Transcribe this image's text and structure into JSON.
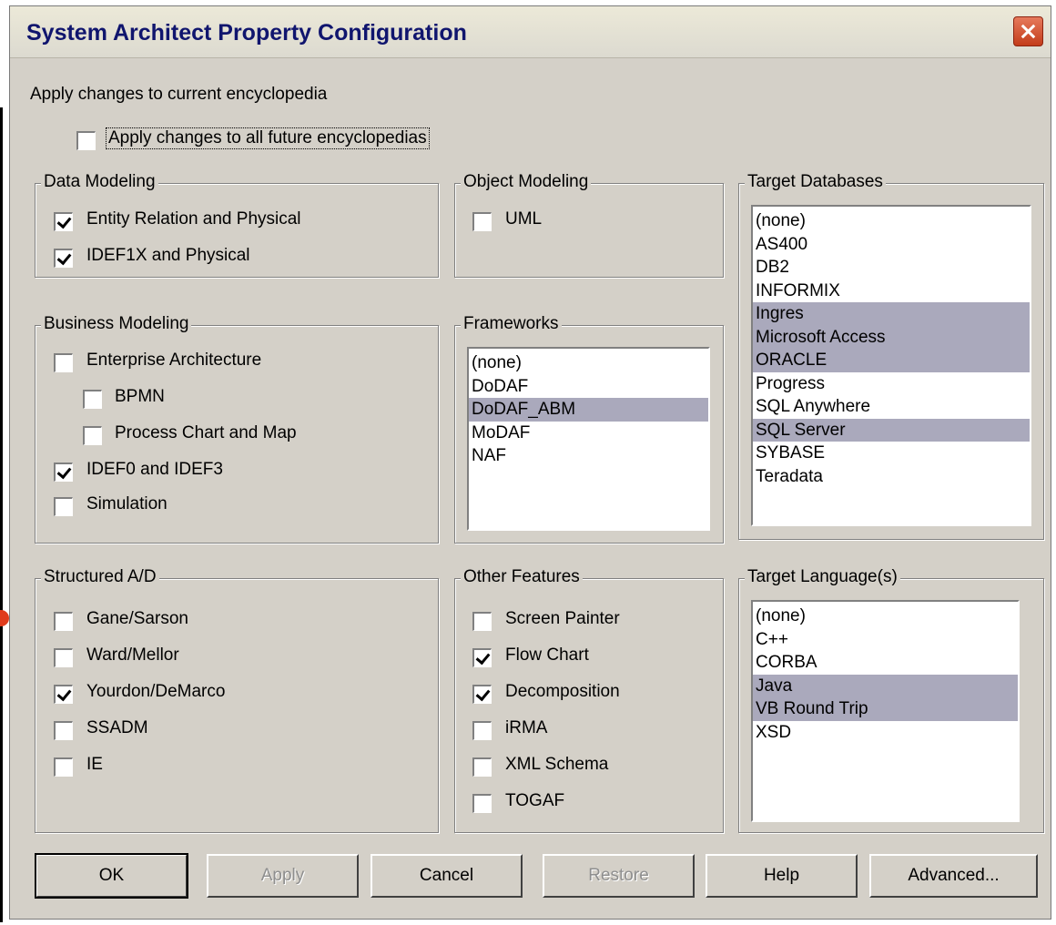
{
  "window": {
    "title": "System Architect Property Configuration"
  },
  "intro": {
    "apply_current": "Apply changes to current encyclopedia",
    "apply_future": {
      "label": "Apply changes to all future encyclopedias",
      "checked": false
    }
  },
  "data_modeling": {
    "title": "Data Modeling",
    "items": [
      {
        "label": "Entity Relation and Physical",
        "checked": true
      },
      {
        "label": "IDEF1X and Physical",
        "checked": true
      }
    ]
  },
  "object_modeling": {
    "title": "Object Modeling",
    "items": [
      {
        "label": "UML",
        "checked": false
      }
    ]
  },
  "target_databases": {
    "title": "Target Databases",
    "items": [
      {
        "label": "(none)",
        "selected": false
      },
      {
        "label": "AS400",
        "selected": false
      },
      {
        "label": "DB2",
        "selected": false
      },
      {
        "label": "INFORMIX",
        "selected": false
      },
      {
        "label": "Ingres",
        "selected": true
      },
      {
        "label": "Microsoft Access",
        "selected": true
      },
      {
        "label": "ORACLE",
        "selected": true
      },
      {
        "label": "Progress",
        "selected": false
      },
      {
        "label": "SQL Anywhere",
        "selected": false
      },
      {
        "label": "SQL Server",
        "selected": true
      },
      {
        "label": "SYBASE",
        "selected": false
      },
      {
        "label": "Teradata",
        "selected": false
      }
    ]
  },
  "business_modeling": {
    "title": "Business Modeling",
    "items": [
      {
        "label": "Enterprise Architecture",
        "checked": false
      },
      {
        "label": "BPMN",
        "checked": false
      },
      {
        "label": "Process Chart and Map",
        "checked": false
      },
      {
        "label": "IDEF0 and IDEF3",
        "checked": true
      },
      {
        "label": "Simulation",
        "checked": false
      }
    ]
  },
  "frameworks": {
    "title": "Frameworks",
    "items": [
      {
        "label": "(none)",
        "selected": false
      },
      {
        "label": "DoDAF",
        "selected": false
      },
      {
        "label": "DoDAF_ABM",
        "selected": true
      },
      {
        "label": "MoDAF",
        "selected": false
      },
      {
        "label": "NAF",
        "selected": false
      }
    ]
  },
  "structured_ad": {
    "title": "Structured A/D",
    "items": [
      {
        "label": "Gane/Sarson",
        "checked": false
      },
      {
        "label": "Ward/Mellor",
        "checked": false
      },
      {
        "label": "Yourdon/DeMarco",
        "checked": true
      },
      {
        "label": "SSADM",
        "checked": false
      },
      {
        "label": "IE",
        "checked": false
      }
    ]
  },
  "other_features": {
    "title": "Other Features",
    "items": [
      {
        "label": "Screen Painter",
        "checked": false
      },
      {
        "label": "Flow Chart",
        "checked": true
      },
      {
        "label": "Decomposition",
        "checked": true
      },
      {
        "label": "iRMA",
        "checked": false
      },
      {
        "label": "XML Schema",
        "checked": false
      },
      {
        "label": "TOGAF",
        "checked": false
      }
    ]
  },
  "target_languages": {
    "title": "Target Language(s)",
    "items": [
      {
        "label": "(none)",
        "selected": false
      },
      {
        "label": "C++",
        "selected": false
      },
      {
        "label": "CORBA",
        "selected": false
      },
      {
        "label": "Java",
        "selected": true
      },
      {
        "label": "VB Round Trip",
        "selected": true
      },
      {
        "label": "XSD",
        "selected": false
      }
    ]
  },
  "buttons": {
    "ok": "OK",
    "apply": "Apply",
    "cancel": "Cancel",
    "restore": "Restore",
    "help": "Help",
    "advanced": "Advanced..."
  }
}
